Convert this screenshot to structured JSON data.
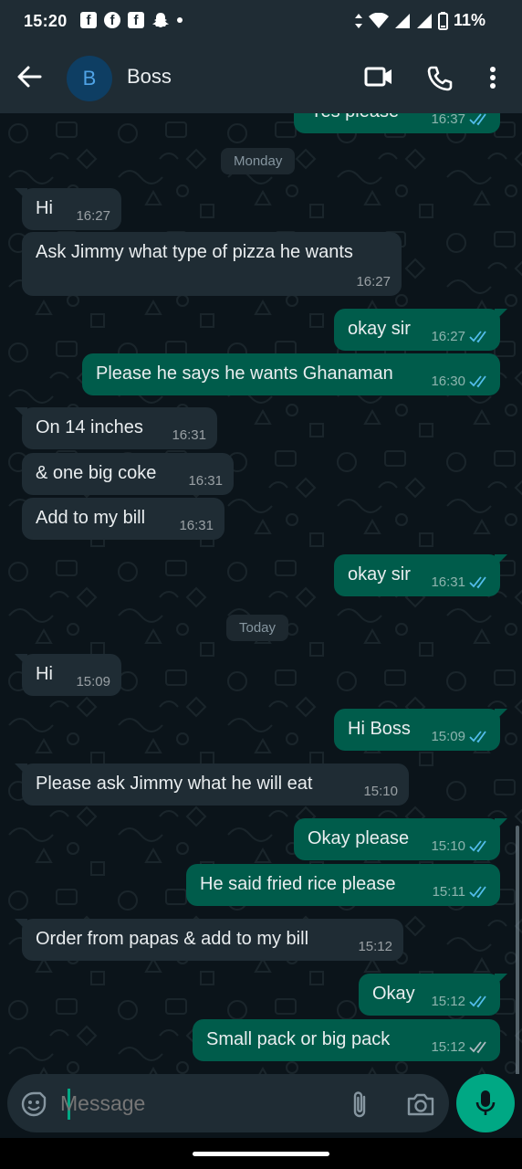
{
  "status_bar": {
    "time": "15:20",
    "apps": [
      "facebook-icon",
      "facebook-messenger-icon",
      "facebook-icon",
      "snapchat-icon"
    ],
    "battery_percent": "11%"
  },
  "header": {
    "avatar_initial": "B",
    "contact_name": "Boss",
    "icons": [
      "back-arrow-icon",
      "video-call-icon",
      "voice-call-icon",
      "more-options-icon"
    ]
  },
  "chat": {
    "partial_top_message": {
      "text": "Yes please",
      "time": "16:37"
    },
    "date_monday": "Monday",
    "date_today": "Today",
    "messages": [
      {
        "direction": "in",
        "text": "Hi",
        "time": "16:27"
      },
      {
        "direction": "in",
        "text": "Ask Jimmy what type of pizza he wants",
        "time": "16:27"
      },
      {
        "direction": "out",
        "text": "okay sir",
        "time": "16:27"
      },
      {
        "direction": "out",
        "text": "Please he says he wants Ghanaman",
        "time": "16:30"
      },
      {
        "direction": "in",
        "text": "On 14 inches",
        "time": "16:31"
      },
      {
        "direction": "in",
        "text": "& one big coke",
        "time": "16:31"
      },
      {
        "direction": "in",
        "text": "Add to my bill",
        "time": "16:31"
      },
      {
        "direction": "out",
        "text": "okay sir",
        "time": "16:31"
      },
      {
        "direction": "in",
        "text": "Hi",
        "time": "15:09"
      },
      {
        "direction": "out",
        "text": "Hi Boss",
        "time": "15:09"
      },
      {
        "direction": "in",
        "text": "Please ask Jimmy what he will eat",
        "time": "15:10"
      },
      {
        "direction": "out",
        "text": "Okay please",
        "time": "15:10"
      },
      {
        "direction": "out",
        "text": "He said fried rice please",
        "time": "15:11"
      },
      {
        "direction": "in",
        "text": "Order from papas & add to my bill",
        "time": "15:12"
      },
      {
        "direction": "out",
        "text": "Okay",
        "time": "15:12"
      },
      {
        "direction": "out",
        "text": "Small pack or  big pack",
        "time": "15:12"
      }
    ]
  },
  "composer": {
    "placeholder": "Message",
    "icons": [
      "emoji-icon",
      "attach-icon",
      "camera-icon",
      "mic-icon"
    ]
  },
  "colors": {
    "background": "#0b141a",
    "bar": "#1f2c34",
    "incoming": "#1f2c34",
    "outgoing": "#005c4b",
    "accent": "#00a884",
    "read_ticks": "#53bdeb",
    "muted": "#8696a0"
  }
}
